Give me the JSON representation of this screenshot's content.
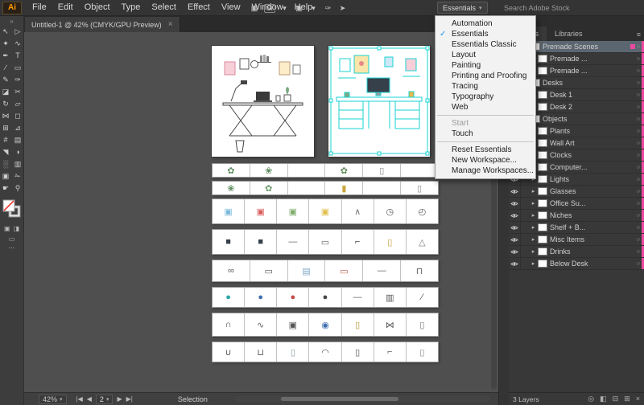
{
  "colors": {
    "selection_accent": "#19d3d3",
    "layer_color": "#ec4aa0",
    "menu_check": "#1a93e0",
    "panel_bg": "#383838",
    "canvas_bg": "#4f4f4f"
  },
  "menubar": {
    "logo": "Ai",
    "menus": [
      "File",
      "Edit",
      "Object",
      "Type",
      "Select",
      "Effect",
      "View",
      "Window",
      "Help"
    ],
    "app_icons": [
      {
        "name": "bridge-icon",
        "glyph": "▦"
      },
      {
        "name": "stock-badge",
        "glyph": "St"
      },
      {
        "name": "caret-icon",
        "glyph": "▾"
      },
      {
        "name": "arrange-documents-icon",
        "glyph": "▣"
      },
      {
        "name": "caret-icon",
        "glyph": "▾"
      },
      {
        "name": "gpu-preview-icon",
        "glyph": "✑"
      },
      {
        "name": "share-icon",
        "glyph": "➤"
      }
    ],
    "workspace_label": "Essentials",
    "workspace_caret": "▾",
    "search_placeholder": "Search Adobe Stock"
  },
  "tabbar": {
    "title": "Untitled-1 @ 42% (CMYK/GPU Preview)",
    "close": "×"
  },
  "workspace_menu": {
    "items": [
      {
        "label": "Automation"
      },
      {
        "label": "Essentials",
        "checked": true
      },
      {
        "label": "Essentials Classic"
      },
      {
        "label": "Layout"
      },
      {
        "label": "Painting"
      },
      {
        "label": "Printing and Proofing"
      },
      {
        "label": "Tracing"
      },
      {
        "label": "Typography"
      },
      {
        "label": "Web"
      },
      {
        "type": "separator"
      },
      {
        "label": "Start",
        "disabled": true
      },
      {
        "label": "Touch"
      },
      {
        "type": "separator"
      },
      {
        "label": "Reset Essentials"
      },
      {
        "label": "New Workspace..."
      },
      {
        "label": "Manage Workspaces..."
      }
    ]
  },
  "tools": [
    {
      "name": "selection-tool",
      "glyph": "↖"
    },
    {
      "name": "direct-selection-tool",
      "glyph": "▷"
    },
    {
      "name": "magic-wand-tool",
      "glyph": "✦"
    },
    {
      "name": "lasso-tool",
      "glyph": "∿"
    },
    {
      "name": "pen-tool",
      "glyph": "✒"
    },
    {
      "name": "type-tool",
      "glyph": "T"
    },
    {
      "name": "line-tool",
      "glyph": "∕"
    },
    {
      "name": "rectangle-tool",
      "glyph": "▭"
    },
    {
      "name": "paintbrush-tool",
      "glyph": "✎"
    },
    {
      "name": "pencil-tool",
      "glyph": "✑"
    },
    {
      "name": "eraser-tool",
      "glyph": "◪"
    },
    {
      "name": "scissors-tool",
      "glyph": "✂"
    },
    {
      "name": "rotate-tool",
      "glyph": "↻"
    },
    {
      "name": "scale-tool",
      "glyph": "▱"
    },
    {
      "name": "width-tool",
      "glyph": "⋈"
    },
    {
      "name": "free-transform-tool",
      "glyph": "◻"
    },
    {
      "name": "shape-builder-tool",
      "glyph": "⊞"
    },
    {
      "name": "perspective-grid-tool",
      "glyph": "⊿"
    },
    {
      "name": "mesh-tool",
      "glyph": "#"
    },
    {
      "name": "gradient-tool",
      "glyph": "▤"
    },
    {
      "name": "eyedropper-tool",
      "glyph": "◥"
    },
    {
      "name": "blend-tool",
      "glyph": "◑"
    },
    {
      "name": "symbol-sprayer-tool",
      "glyph": "░"
    },
    {
      "name": "column-graph-tool",
      "glyph": "▥"
    },
    {
      "name": "artboard-tool",
      "glyph": "▣"
    },
    {
      "name": "slice-tool",
      "glyph": "✁"
    },
    {
      "name": "hand-tool",
      "glyph": "☛"
    },
    {
      "name": "zoom-tool",
      "glyph": "⚲"
    }
  ],
  "layers_panel": {
    "tabs": [
      {
        "label": "Layers",
        "active": true
      },
      {
        "label": "Libraries",
        "active": false
      }
    ],
    "rows": [
      {
        "name": "Premade Scenes",
        "level": 0,
        "chevron": "down",
        "selected": true
      },
      {
        "name": "Premade ...",
        "level": 1,
        "chevron": "right"
      },
      {
        "name": "Premade ...",
        "level": 1,
        "chevron": "right"
      },
      {
        "name": "Desks",
        "level": 0,
        "chevron": "down"
      },
      {
        "name": "Desk 1",
        "level": 1,
        "chevron": "right"
      },
      {
        "name": "Desk 2",
        "level": 1,
        "chevron": "right"
      },
      {
        "name": "Objects",
        "level": 0,
        "chevron": "down"
      },
      {
        "name": "Plants",
        "level": 1,
        "chevron": "right"
      },
      {
        "name": "Wall Art",
        "level": 1,
        "chevron": "right"
      },
      {
        "name": "Clocks",
        "level": 1,
        "chevron": "right"
      },
      {
        "name": "Computer...",
        "level": 1,
        "chevron": "right"
      },
      {
        "name": "Lights",
        "level": 1,
        "chevron": "right"
      },
      {
        "name": "Glasses",
        "level": 1,
        "chevron": "right"
      },
      {
        "name": "Office Su...",
        "level": 1,
        "chevron": "right"
      },
      {
        "name": "Niches",
        "level": 1,
        "chevron": "right"
      },
      {
        "name": "Shelf + B...",
        "level": 1,
        "chevron": "right"
      },
      {
        "name": "Misc Items",
        "level": 1,
        "chevron": "right"
      },
      {
        "name": "Drinks",
        "level": 1,
        "chevron": "right"
      },
      {
        "name": "Below Desk",
        "level": 1,
        "chevron": "right"
      }
    ],
    "footer": {
      "count": "3 Layers",
      "icons": [
        {
          "name": "locate-object-icon",
          "glyph": "◎"
        },
        {
          "name": "make-mask-icon",
          "glyph": "◧"
        },
        {
          "name": "new-sublayer-icon",
          "glyph": "⊟"
        },
        {
          "name": "new-layer-icon",
          "glyph": "⊞"
        },
        {
          "name": "delete-layer-icon",
          "glyph": "×"
        }
      ]
    }
  },
  "statusbar": {
    "zoom": "42%",
    "zoom_caret": "▾",
    "artboard": "2",
    "tool": "Selection",
    "nav": {
      "first": "|◀",
      "prev": "◀",
      "next": "▶",
      "last": "▶|"
    }
  },
  "dockstrip_icons": [
    {
      "name": "expand-panels-icon",
      "glyph": "«"
    },
    {
      "name": "color-panel-icon",
      "glyph": "▤"
    },
    {
      "name": "swatches-panel-icon",
      "glyph": "◧"
    }
  ],
  "canvas": {
    "symbol_rows": [
      {
        "h": 18,
        "gap": 0,
        "cells": [
          {
            "g": "✿",
            "c": "#5e8c5e"
          },
          {
            "g": "❀",
            "c": "#5e8c5e"
          },
          {
            "g": "",
            "c": ""
          },
          {
            "g": "✿",
            "c": "#5e8c5e"
          },
          {
            "g": "▯",
            "c": "#8a8a8a"
          },
          {
            "g": "",
            "c": ""
          }
        ]
      },
      {
        "h": 18,
        "gap": 4,
        "cells": [
          {
            "g": "❀",
            "c": "#5e8c5e"
          },
          {
            "g": "✿",
            "c": "#6a9c6a"
          },
          {
            "g": "",
            "c": ""
          },
          {
            "g": "▮",
            "c": "#caa53f"
          },
          {
            "g": "",
            "c": ""
          },
          {
            "g": "▯",
            "c": "#8a8a8a"
          }
        ]
      },
      {
        "h": 32,
        "gap": 4,
        "cells": [
          {
            "g": "▣",
            "c": "#7ab8d9"
          },
          {
            "g": "▣",
            "c": "#d95f5f"
          },
          {
            "g": "▣",
            "c": "#7fae6b"
          },
          {
            "g": "▣",
            "c": "#e0c04f"
          },
          {
            "g": "∧",
            "c": "#777777"
          },
          {
            "g": "◷",
            "c": "#555555"
          },
          {
            "g": "◴",
            "c": "#555555"
          }
        ]
      },
      {
        "h": 32,
        "gap": 6,
        "cells": [
          {
            "g": "■",
            "c": "#35404a"
          },
          {
            "g": "■",
            "c": "#35404a"
          },
          {
            "g": "—",
            "c": "#666666"
          },
          {
            "g": "▭",
            "c": "#666666"
          },
          {
            "g": "⌐",
            "c": "#444444"
          },
          {
            "g": "▯",
            "c": "#c2a23d"
          },
          {
            "g": "△",
            "c": "#777777"
          }
        ]
      },
      {
        "h": 28,
        "gap": 6,
        "cells": [
          {
            "g": "∞",
            "c": "#555555"
          },
          {
            "g": "▭",
            "c": "#555555"
          },
          {
            "g": "▤",
            "c": "#7da7c4"
          },
          {
            "g": "▭",
            "c": "#c05a4a"
          },
          {
            "g": "—",
            "c": "#666666"
          },
          {
            "g": "⊓",
            "c": "#555555"
          }
        ]
      },
      {
        "h": 26,
        "gap": 6,
        "cells": [
          {
            "g": "●",
            "c": "#2ba3a3"
          },
          {
            "g": "●",
            "c": "#3f6fae"
          },
          {
            "g": "●",
            "c": "#c24d44"
          },
          {
            "g": "●",
            "c": "#444444"
          },
          {
            "g": "—",
            "c": "#666666"
          },
          {
            "g": "▥",
            "c": "#555555"
          },
          {
            "g": "∕",
            "c": "#555555"
          }
        ]
      },
      {
        "h": 30,
        "gap": 6,
        "cells": [
          {
            "g": "∩",
            "c": "#444444"
          },
          {
            "g": "∿",
            "c": "#666666"
          },
          {
            "g": "▣",
            "c": "#555555"
          },
          {
            "g": "◉",
            "c": "#3f6fae"
          },
          {
            "g": "▯",
            "c": "#b49a3a"
          },
          {
            "g": "⋈",
            "c": "#555555"
          },
          {
            "g": "▯",
            "c": "#777777"
          }
        ]
      },
      {
        "h": 26,
        "gap": 6,
        "cells": [
          {
            "g": "∪",
            "c": "#555555"
          },
          {
            "g": "⊔",
            "c": "#555555"
          },
          {
            "g": "▯",
            "c": "#8a9aa5"
          },
          {
            "g": "◠",
            "c": "#555555"
          },
          {
            "g": "▯",
            "c": "#555555"
          },
          {
            "g": "⌐",
            "c": "#666666"
          },
          {
            "g": "▯",
            "c": "#888888"
          }
        ]
      }
    ]
  }
}
